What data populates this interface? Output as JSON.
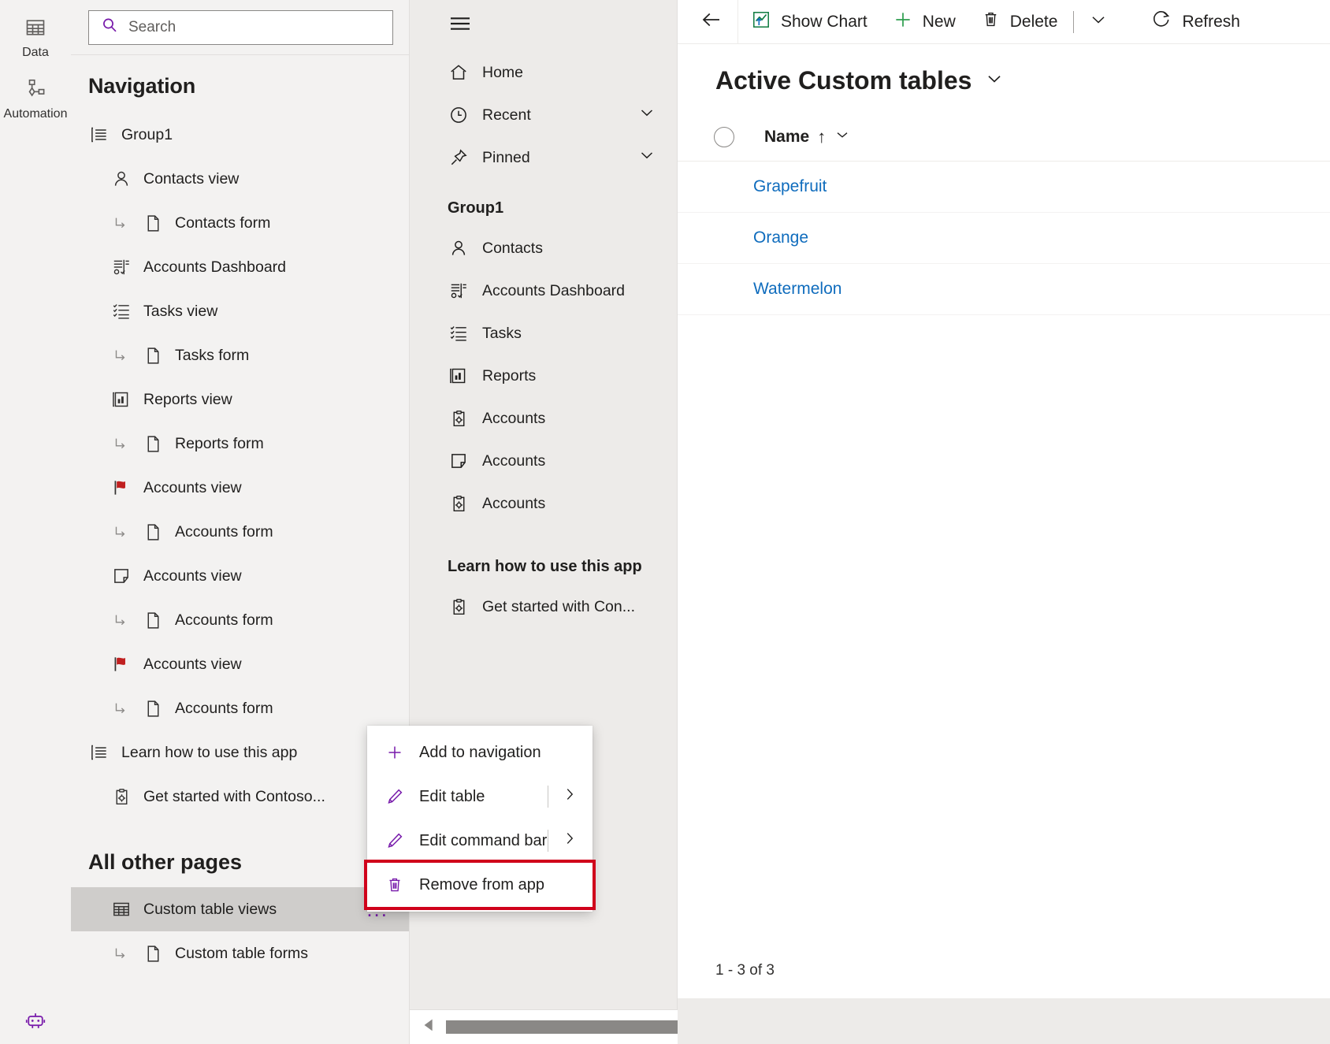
{
  "rail": {
    "items": [
      {
        "label": "Data",
        "icon": "table-icon"
      },
      {
        "label": "Automation",
        "icon": "automation-flow-icon"
      }
    ],
    "bottom_icon": "copilot-bot-icon"
  },
  "search": {
    "placeholder": "Search",
    "icon": "search-icon"
  },
  "navigation": {
    "title": "Navigation",
    "all_other_pages_title": "All other pages",
    "items": [
      {
        "label": "Group1",
        "icon": "group-list-icon",
        "level": "group"
      },
      {
        "label": "Contacts view",
        "icon": "contact-person-icon",
        "level": "1"
      },
      {
        "label": "Contacts form",
        "icon": "form-page-icon",
        "level": "2",
        "connector": true
      },
      {
        "label": "Accounts Dashboard",
        "icon": "dashboard-icon",
        "level": "1"
      },
      {
        "label": "Tasks view",
        "icon": "task-list-icon",
        "level": "1"
      },
      {
        "label": "Tasks form",
        "icon": "form-page-icon",
        "level": "2",
        "connector": true
      },
      {
        "label": "Reports view",
        "icon": "report-chart-icon",
        "level": "1"
      },
      {
        "label": "Reports form",
        "icon": "form-page-icon",
        "level": "2",
        "connector": true
      },
      {
        "label": "Accounts view",
        "icon": "red-flag-icon",
        "level": "1"
      },
      {
        "label": "Accounts form",
        "icon": "form-page-icon",
        "level": "2",
        "connector": true
      },
      {
        "label": "Accounts view",
        "icon": "folder-open-icon",
        "level": "1"
      },
      {
        "label": "Accounts form",
        "icon": "form-page-icon",
        "level": "2",
        "connector": true
      },
      {
        "label": "Accounts view",
        "icon": "red-flag-icon",
        "level": "1"
      },
      {
        "label": "Accounts form",
        "icon": "form-page-icon",
        "level": "2",
        "connector": true
      },
      {
        "label": "Learn how to use this app",
        "icon": "group-list-icon",
        "level": "group"
      },
      {
        "label": "Get started with Contoso...",
        "icon": "clipboard-gear-icon",
        "level": "1"
      }
    ],
    "other_pages": [
      {
        "label": "Custom table views",
        "icon": "table-grid-icon",
        "selected": true,
        "overflow": "..."
      },
      {
        "label": "Custom table forms",
        "icon": "form-page-icon",
        "level": "2",
        "connector": true
      }
    ]
  },
  "context_menu": {
    "items": [
      {
        "label": "Add to navigation",
        "icon": "plus-icon",
        "submenu": false,
        "highlighted": false
      },
      {
        "label": "Edit table",
        "icon": "pencil-icon",
        "submenu": true,
        "highlighted": false
      },
      {
        "label": "Edit command bar",
        "icon": "pencil-icon",
        "submenu": true,
        "highlighted": false
      },
      {
        "label": "Remove from app",
        "icon": "trash-icon",
        "submenu": false,
        "highlighted": true
      }
    ],
    "highlight_color": "#d0021b",
    "icon_color": "#7719aa"
  },
  "sitemap_preview": {
    "hamburger_icon": "hamburger-icon",
    "top_items": [
      {
        "label": "Home",
        "icon": "home-icon",
        "chevron": false
      },
      {
        "label": "Recent",
        "icon": "clock-icon",
        "chevron": true
      },
      {
        "label": "Pinned",
        "icon": "pin-icon",
        "chevron": true
      }
    ],
    "groups": [
      {
        "title": "Group1",
        "items": [
          {
            "label": "Contacts",
            "icon": "contact-person-icon"
          },
          {
            "label": "Accounts Dashboard",
            "icon": "dashboard-icon"
          },
          {
            "label": "Tasks",
            "icon": "task-list-icon"
          },
          {
            "label": "Reports",
            "icon": "report-chart-icon"
          },
          {
            "label": "Accounts",
            "icon": "clipboard-gear-icon"
          },
          {
            "label": "Accounts",
            "icon": "folder-open-icon"
          },
          {
            "label": "Accounts",
            "icon": "clipboard-gear-icon"
          }
        ]
      },
      {
        "title": "Learn how to use this app",
        "items": [
          {
            "label": "Get started with Con...",
            "icon": "clipboard-gear-icon"
          }
        ]
      }
    ]
  },
  "content": {
    "commandbar": {
      "back_icon": "arrow-left-icon",
      "buttons": [
        {
          "label": "Show Chart",
          "icon": "show-chart-icon"
        },
        {
          "label": "New",
          "icon": "plus-icon"
        },
        {
          "label": "Delete",
          "icon": "trash-icon"
        }
      ],
      "overflow_icon": "chevron-down-icon",
      "refresh": {
        "label": "Refresh",
        "icon": "refresh-icon"
      }
    },
    "view_title": "Active Custom tables",
    "view_title_chevron": "chevron-down-icon",
    "grid": {
      "columns": [
        "Name"
      ],
      "sort_indicator": "↑",
      "rows": [
        {
          "Name": "Grapefruit"
        },
        {
          "Name": "Orange"
        },
        {
          "Name": "Watermelon"
        }
      ]
    },
    "record_count": "1 - 3 of 3"
  },
  "colors": {
    "link": "#0f6cbd",
    "accent_purple": "#7719aa",
    "flag_red": "#c02020",
    "highlight_red": "#d0021b",
    "green": "#4caf50"
  }
}
